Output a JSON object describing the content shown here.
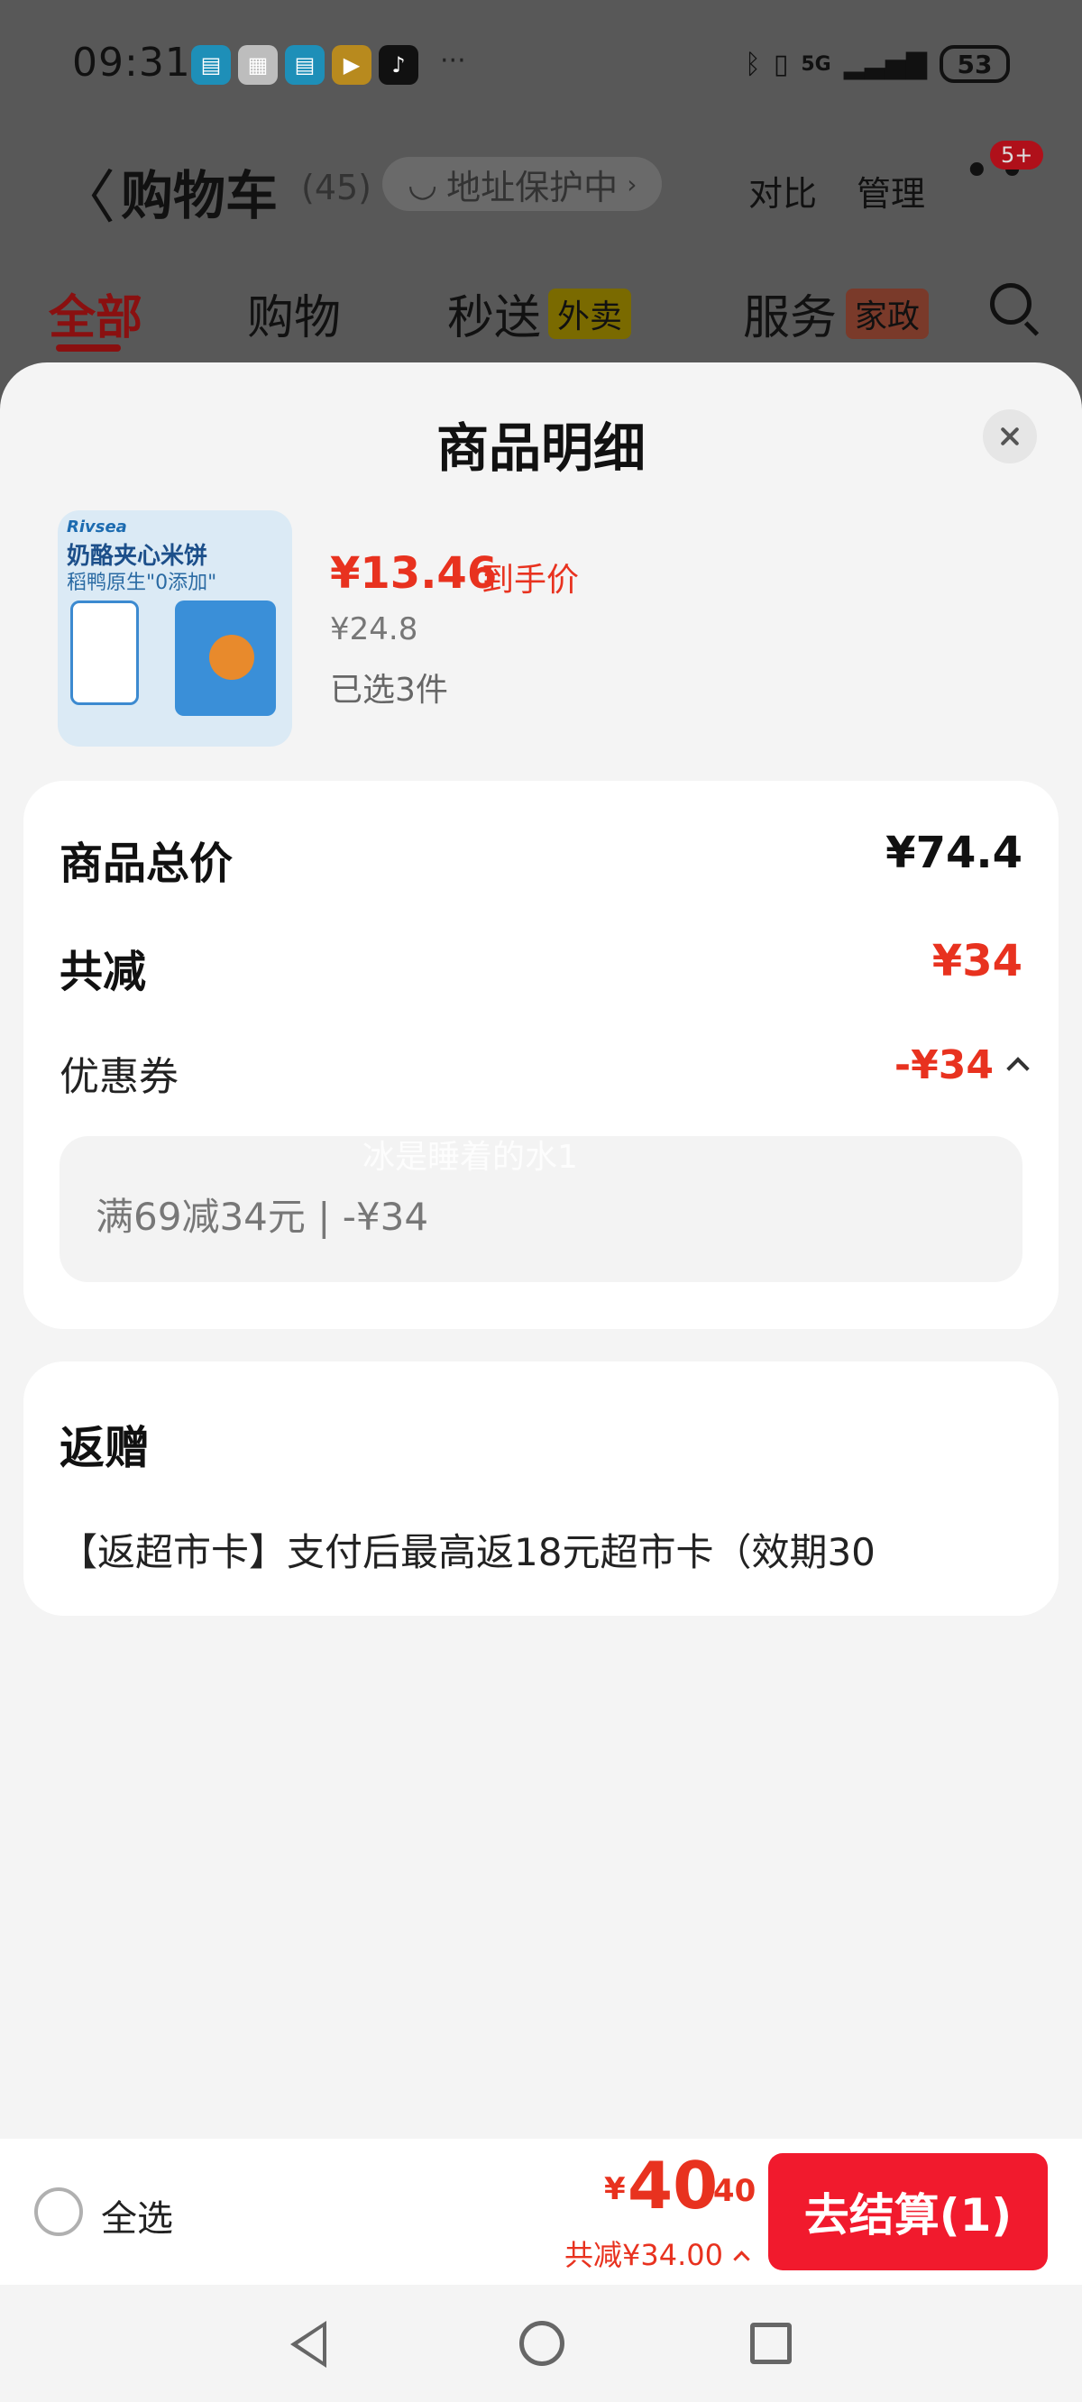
{
  "statusbar": {
    "time": "09:31",
    "app_icons": [
      "book-app-icon",
      "calendar-app-icon",
      "reader-app-icon",
      "video-app-icon",
      "tiktok-app-icon"
    ],
    "more_dots": "···",
    "signal": "5G",
    "battery": "53"
  },
  "nav": {
    "title": "购物车",
    "count": "(45)",
    "address_protect": "地址保护中",
    "compare": "对比",
    "manage": "管理",
    "badge": "5+"
  },
  "tabs": [
    {
      "label": "全部",
      "active": true
    },
    {
      "label": "购物",
      "active": false
    },
    {
      "label": "秒送",
      "tag": "外卖",
      "active": false
    },
    {
      "label": "服务",
      "tag": "家政",
      "active": false
    }
  ],
  "sheet": {
    "title": "商品明细",
    "product": {
      "image_brand": "Rivsea",
      "image_title": "奶酪夹心米饼",
      "image_subtitle": "稻鸭原生\"0添加\"",
      "price_now": "¥13.46",
      "price_tag": "到手价",
      "price_orig": "¥24.8",
      "selected": "已选3件"
    },
    "summary": {
      "total_label": "商品总价",
      "total_value": "¥74.4",
      "reduce_label": "共减",
      "reduce_value": "¥34",
      "coupon_label": "优惠券",
      "coupon_value": "-¥34",
      "coupon_detail": "满69减34元 | -¥34"
    },
    "watermark": "冰是睡着的水1",
    "gift": {
      "title": "返赠",
      "text": "【返超市卡】支付后最高返18元超市卡（效期30"
    }
  },
  "checkout": {
    "select_all": "全选",
    "total_yen": "¥",
    "total_int": "40",
    "total_dec": ".40",
    "total_reduce": "共减¥34.00",
    "pay_button": "去结算(1)"
  },
  "colors": {
    "accent_red": "#e8321f",
    "button_red": "#f11a2d",
    "sheet_bg": "#f4f4f4",
    "overlay": "#585858"
  }
}
